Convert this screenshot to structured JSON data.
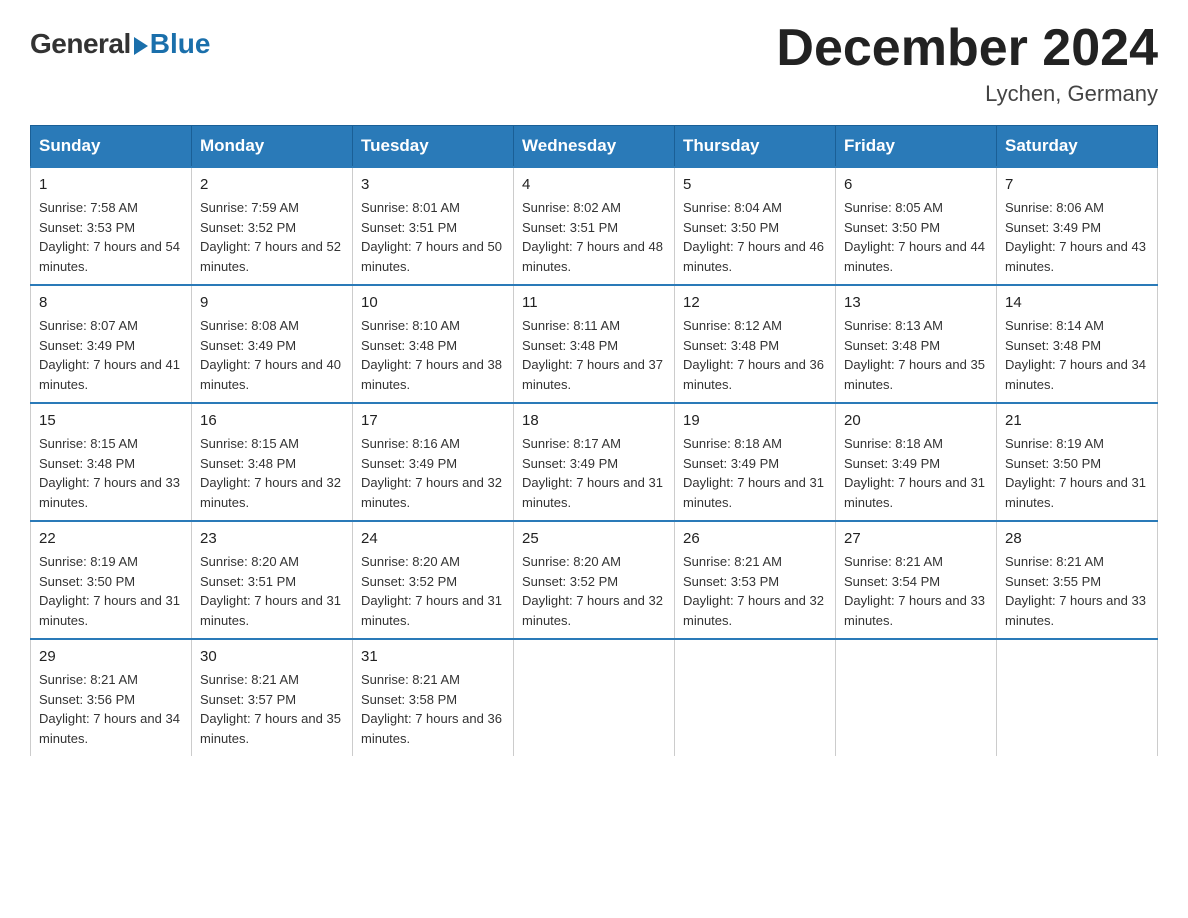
{
  "logo": {
    "general": "General",
    "blue": "Blue"
  },
  "title": "December 2024",
  "subtitle": "Lychen, Germany",
  "headers": [
    "Sunday",
    "Monday",
    "Tuesday",
    "Wednesday",
    "Thursday",
    "Friday",
    "Saturday"
  ],
  "weeks": [
    [
      {
        "day": "1",
        "sunrise": "Sunrise: 7:58 AM",
        "sunset": "Sunset: 3:53 PM",
        "daylight": "Daylight: 7 hours and 54 minutes."
      },
      {
        "day": "2",
        "sunrise": "Sunrise: 7:59 AM",
        "sunset": "Sunset: 3:52 PM",
        "daylight": "Daylight: 7 hours and 52 minutes."
      },
      {
        "day": "3",
        "sunrise": "Sunrise: 8:01 AM",
        "sunset": "Sunset: 3:51 PM",
        "daylight": "Daylight: 7 hours and 50 minutes."
      },
      {
        "day": "4",
        "sunrise": "Sunrise: 8:02 AM",
        "sunset": "Sunset: 3:51 PM",
        "daylight": "Daylight: 7 hours and 48 minutes."
      },
      {
        "day": "5",
        "sunrise": "Sunrise: 8:04 AM",
        "sunset": "Sunset: 3:50 PM",
        "daylight": "Daylight: 7 hours and 46 minutes."
      },
      {
        "day": "6",
        "sunrise": "Sunrise: 8:05 AM",
        "sunset": "Sunset: 3:50 PM",
        "daylight": "Daylight: 7 hours and 44 minutes."
      },
      {
        "day": "7",
        "sunrise": "Sunrise: 8:06 AM",
        "sunset": "Sunset: 3:49 PM",
        "daylight": "Daylight: 7 hours and 43 minutes."
      }
    ],
    [
      {
        "day": "8",
        "sunrise": "Sunrise: 8:07 AM",
        "sunset": "Sunset: 3:49 PM",
        "daylight": "Daylight: 7 hours and 41 minutes."
      },
      {
        "day": "9",
        "sunrise": "Sunrise: 8:08 AM",
        "sunset": "Sunset: 3:49 PM",
        "daylight": "Daylight: 7 hours and 40 minutes."
      },
      {
        "day": "10",
        "sunrise": "Sunrise: 8:10 AM",
        "sunset": "Sunset: 3:48 PM",
        "daylight": "Daylight: 7 hours and 38 minutes."
      },
      {
        "day": "11",
        "sunrise": "Sunrise: 8:11 AM",
        "sunset": "Sunset: 3:48 PM",
        "daylight": "Daylight: 7 hours and 37 minutes."
      },
      {
        "day": "12",
        "sunrise": "Sunrise: 8:12 AM",
        "sunset": "Sunset: 3:48 PM",
        "daylight": "Daylight: 7 hours and 36 minutes."
      },
      {
        "day": "13",
        "sunrise": "Sunrise: 8:13 AM",
        "sunset": "Sunset: 3:48 PM",
        "daylight": "Daylight: 7 hours and 35 minutes."
      },
      {
        "day": "14",
        "sunrise": "Sunrise: 8:14 AM",
        "sunset": "Sunset: 3:48 PM",
        "daylight": "Daylight: 7 hours and 34 minutes."
      }
    ],
    [
      {
        "day": "15",
        "sunrise": "Sunrise: 8:15 AM",
        "sunset": "Sunset: 3:48 PM",
        "daylight": "Daylight: 7 hours and 33 minutes."
      },
      {
        "day": "16",
        "sunrise": "Sunrise: 8:15 AM",
        "sunset": "Sunset: 3:48 PM",
        "daylight": "Daylight: 7 hours and 32 minutes."
      },
      {
        "day": "17",
        "sunrise": "Sunrise: 8:16 AM",
        "sunset": "Sunset: 3:49 PM",
        "daylight": "Daylight: 7 hours and 32 minutes."
      },
      {
        "day": "18",
        "sunrise": "Sunrise: 8:17 AM",
        "sunset": "Sunset: 3:49 PM",
        "daylight": "Daylight: 7 hours and 31 minutes."
      },
      {
        "day": "19",
        "sunrise": "Sunrise: 8:18 AM",
        "sunset": "Sunset: 3:49 PM",
        "daylight": "Daylight: 7 hours and 31 minutes."
      },
      {
        "day": "20",
        "sunrise": "Sunrise: 8:18 AM",
        "sunset": "Sunset: 3:49 PM",
        "daylight": "Daylight: 7 hours and 31 minutes."
      },
      {
        "day": "21",
        "sunrise": "Sunrise: 8:19 AM",
        "sunset": "Sunset: 3:50 PM",
        "daylight": "Daylight: 7 hours and 31 minutes."
      }
    ],
    [
      {
        "day": "22",
        "sunrise": "Sunrise: 8:19 AM",
        "sunset": "Sunset: 3:50 PM",
        "daylight": "Daylight: 7 hours and 31 minutes."
      },
      {
        "day": "23",
        "sunrise": "Sunrise: 8:20 AM",
        "sunset": "Sunset: 3:51 PM",
        "daylight": "Daylight: 7 hours and 31 minutes."
      },
      {
        "day": "24",
        "sunrise": "Sunrise: 8:20 AM",
        "sunset": "Sunset: 3:52 PM",
        "daylight": "Daylight: 7 hours and 31 minutes."
      },
      {
        "day": "25",
        "sunrise": "Sunrise: 8:20 AM",
        "sunset": "Sunset: 3:52 PM",
        "daylight": "Daylight: 7 hours and 32 minutes."
      },
      {
        "day": "26",
        "sunrise": "Sunrise: 8:21 AM",
        "sunset": "Sunset: 3:53 PM",
        "daylight": "Daylight: 7 hours and 32 minutes."
      },
      {
        "day": "27",
        "sunrise": "Sunrise: 8:21 AM",
        "sunset": "Sunset: 3:54 PM",
        "daylight": "Daylight: 7 hours and 33 minutes."
      },
      {
        "day": "28",
        "sunrise": "Sunrise: 8:21 AM",
        "sunset": "Sunset: 3:55 PM",
        "daylight": "Daylight: 7 hours and 33 minutes."
      }
    ],
    [
      {
        "day": "29",
        "sunrise": "Sunrise: 8:21 AM",
        "sunset": "Sunset: 3:56 PM",
        "daylight": "Daylight: 7 hours and 34 minutes."
      },
      {
        "day": "30",
        "sunrise": "Sunrise: 8:21 AM",
        "sunset": "Sunset: 3:57 PM",
        "daylight": "Daylight: 7 hours and 35 minutes."
      },
      {
        "day": "31",
        "sunrise": "Sunrise: 8:21 AM",
        "sunset": "Sunset: 3:58 PM",
        "daylight": "Daylight: 7 hours and 36 minutes."
      },
      null,
      null,
      null,
      null
    ]
  ]
}
